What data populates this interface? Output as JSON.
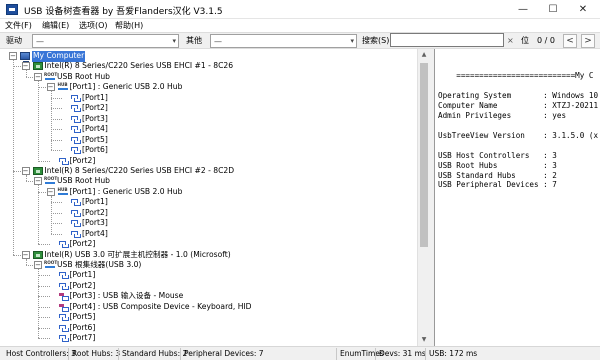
{
  "window": {
    "title": "USB 设备树查看器 by 吾爱Flanders汉化 V3.1.5",
    "min_glyph": "—",
    "max_glyph": "☐",
    "close_glyph": "✕"
  },
  "menu": [
    "文件(F)",
    "编辑(E)",
    "选项(O)",
    "帮助(H)"
  ],
  "toolbar": {
    "driver_label": "驱动",
    "driver_value": "—",
    "other_label": "其他",
    "other_value": "—",
    "search_label": "搜索(S)",
    "search_value": "",
    "search_close": "×",
    "position_label": "位",
    "match_count": "0 / 0",
    "prev_glyph": "<",
    "next_glyph": ">",
    "dropdown_glyph": "▾"
  },
  "tree": [
    {
      "label": "My Computer",
      "icon": "computer",
      "level": 0,
      "expanded": true,
      "selected": true
    },
    {
      "label": "Intel(R) 8 Series/C220 Series USB EHCI #1 - 8C26",
      "icon": "host-controller",
      "level": 1,
      "expanded": true
    },
    {
      "label": "USB Root Hub",
      "icon": "root-hub",
      "level": 2,
      "expanded": true
    },
    {
      "label": "[Port1] : Generic USB 2.0 Hub",
      "icon": "hub",
      "level": 3,
      "expanded": true
    },
    {
      "label": "[Port1]",
      "icon": "port",
      "level": 4
    },
    {
      "label": "[Port2]",
      "icon": "port",
      "level": 4
    },
    {
      "label": "[Port3]",
      "icon": "port",
      "level": 4
    },
    {
      "label": "[Port4]",
      "icon": "port",
      "level": 4
    },
    {
      "label": "[Port5]",
      "icon": "port",
      "level": 4
    },
    {
      "label": "[Port6]",
      "icon": "port",
      "level": 4
    },
    {
      "label": "[Port2]",
      "icon": "port",
      "level": 3
    },
    {
      "label": "Intel(R) 8 Series/C220 Series USB EHCI #2 - 8C2D",
      "icon": "host-controller",
      "level": 1,
      "expanded": true
    },
    {
      "label": "USB Root Hub",
      "icon": "root-hub",
      "level": 2,
      "expanded": true
    },
    {
      "label": "[Port1] : Generic USB 2.0 Hub",
      "icon": "hub",
      "level": 3,
      "expanded": true
    },
    {
      "label": "[Port1]",
      "icon": "port",
      "level": 4
    },
    {
      "label": "[Port2]",
      "icon": "port",
      "level": 4
    },
    {
      "label": "[Port3]",
      "icon": "port",
      "level": 4
    },
    {
      "label": "[Port4]",
      "icon": "port",
      "level": 4
    },
    {
      "label": "[Port2]",
      "icon": "port",
      "level": 3
    },
    {
      "label": "Intel(R) USB 3.0 可扩展主机控制器 - 1.0 (Microsoft)",
      "icon": "host-controller",
      "level": 1,
      "expanded": true
    },
    {
      "label": "USB 根集线器(USB 3.0)",
      "icon": "root-hub",
      "level": 2,
      "expanded": true
    },
    {
      "label": "[Port1]",
      "icon": "port",
      "level": 3
    },
    {
      "label": "[Port2]",
      "icon": "port",
      "level": 3
    },
    {
      "label": "[Port3] : USB 输入设备 - Mouse",
      "icon": "device",
      "level": 3
    },
    {
      "label": "[Port4] : USB Composite Device - Keyboard, HID",
      "icon": "device",
      "level": 3
    },
    {
      "label": "[Port5]",
      "icon": "port",
      "level": 3
    },
    {
      "label": "[Port6]",
      "icon": "port",
      "level": 3
    },
    {
      "label": "[Port7]",
      "icon": "port",
      "level": 3
    }
  ],
  "report": [
    "    ==========================My C",
    "",
    "Operating System       : Windows 10",
    "Computer Name          : XTZJ-20211",
    "Admin Privileges       : yes",
    "",
    "UsbTreeView Version    : 3.1.5.0 (x",
    "",
    "USB Host Controllers   : 3",
    "USB Root Hubs          : 3",
    "USB Standard Hubs      : 2",
    "USB Peripheral Devices : 7"
  ],
  "status": {
    "host_controllers": "Host Controllers: 3",
    "root_hubs": "Root Hubs: 3",
    "standard_hubs": "Standard Hubs: 2",
    "peripheral_devices": "Peripheral Devices: 7",
    "enum_times": "EnumTimes",
    "devs": "Devs: 31 ms",
    "usb": "USB: 172 ms"
  }
}
